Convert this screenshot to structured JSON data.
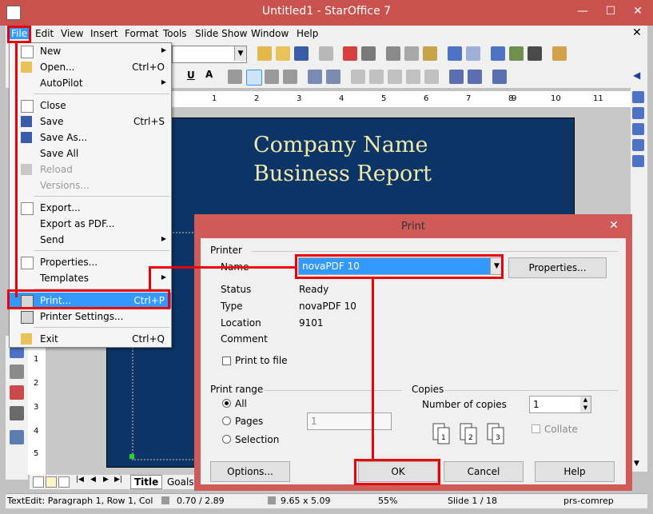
{
  "window": {
    "title": "Untitled1 - StarOffice 7"
  },
  "window_controls": {
    "minimize": "—",
    "maximize": "☐",
    "close": "✕",
    "doc_close": "✕"
  },
  "menubar": {
    "items": [
      "File",
      "Edit",
      "View",
      "Insert",
      "Format",
      "Tools",
      "Slide Show",
      "Window",
      "Help"
    ]
  },
  "file_menu": {
    "items": [
      {
        "label": "New",
        "shortcut": "",
        "submenu": true,
        "enabled": true,
        "icon": "new-doc-icon"
      },
      {
        "label": "Open...",
        "shortcut": "Ctrl+O",
        "submenu": false,
        "enabled": true,
        "icon": "open-folder-icon"
      },
      {
        "label": "AutoPilot",
        "shortcut": "",
        "submenu": true,
        "enabled": true,
        "icon": ""
      },
      {
        "label": "Close",
        "shortcut": "",
        "submenu": false,
        "enabled": true,
        "icon": "close-doc-icon"
      },
      {
        "label": "Save",
        "shortcut": "Ctrl+S",
        "submenu": false,
        "enabled": true,
        "icon": "save-icon"
      },
      {
        "label": "Save As...",
        "shortcut": "",
        "submenu": false,
        "enabled": true,
        "icon": "save-as-icon"
      },
      {
        "label": "Save All",
        "shortcut": "",
        "submenu": false,
        "enabled": true,
        "icon": ""
      },
      {
        "label": "Reload",
        "shortcut": "",
        "submenu": false,
        "enabled": false,
        "icon": "reload-icon"
      },
      {
        "label": "Versions...",
        "shortcut": "",
        "submenu": false,
        "enabled": false,
        "icon": ""
      },
      {
        "label": "Export...",
        "shortcut": "",
        "submenu": false,
        "enabled": true,
        "icon": "export-icon"
      },
      {
        "label": "Export as PDF...",
        "shortcut": "",
        "submenu": false,
        "enabled": true,
        "icon": ""
      },
      {
        "label": "Send",
        "shortcut": "",
        "submenu": true,
        "enabled": true,
        "icon": ""
      },
      {
        "label": "Properties...",
        "shortcut": "",
        "submenu": false,
        "enabled": true,
        "icon": "properties-icon"
      },
      {
        "label": "Templates",
        "shortcut": "",
        "submenu": true,
        "enabled": true,
        "icon": ""
      },
      {
        "label": "Print...",
        "shortcut": "Ctrl+P",
        "submenu": false,
        "enabled": true,
        "icon": "printer-icon"
      },
      {
        "label": "Printer Settings...",
        "shortcut": "",
        "submenu": false,
        "enabled": true,
        "icon": "printer-settings-icon"
      },
      {
        "label": "Exit",
        "shortcut": "Ctrl+Q",
        "submenu": false,
        "enabled": true,
        "icon": "exit-icon"
      }
    ]
  },
  "ruler": {
    "numbers": [
      "1",
      "2",
      "3",
      "4",
      "5",
      "6",
      "7",
      "8",
      "9",
      "10",
      "11"
    ]
  },
  "vruler": {
    "numbers": [
      "1",
      "2",
      "3",
      "4",
      "5"
    ]
  },
  "slide": {
    "title_line1": "Company Name",
    "title_line2": "Business Report"
  },
  "tabs": {
    "items": [
      "Title",
      "Goals"
    ]
  },
  "statusbar": {
    "context": "TextEdit: Paragraph 1, Row 1, Col",
    "position": "0.70 / 2.89",
    "size": "9.65 x 5.09",
    "zoom": "55%",
    "slide": "Slide 1 / 18",
    "layout": "prs-comrep"
  },
  "print_dialog": {
    "title": "Print",
    "printer_section": "Printer",
    "name_label": "Name",
    "name_value": "novaPDF 10",
    "properties_button": "Properties...",
    "status_label": "Status",
    "status_value": "Ready",
    "type_label": "Type",
    "type_value": "novaPDF 10",
    "location_label": "Location",
    "location_value": "9101",
    "comment_label": "Comment",
    "comment_value": "",
    "print_to_file": "Print to file",
    "print_range_section": "Print range",
    "range_all": "All",
    "range_pages": "Pages",
    "pages_value": "1",
    "range_selection": "Selection",
    "copies_section": "Copies",
    "number_of_copies": "Number of copies",
    "copies_value": "1",
    "collate": "Collate",
    "options_button": "Options...",
    "ok_button": "OK",
    "cancel_button": "Cancel",
    "help_button": "Help"
  },
  "colors": {
    "annotation": "#e8000b",
    "titlebar": "#c9514e",
    "slide_bg": "#0b3467",
    "slide_text": "#f3e9a8",
    "highlight": "#3399ff"
  }
}
